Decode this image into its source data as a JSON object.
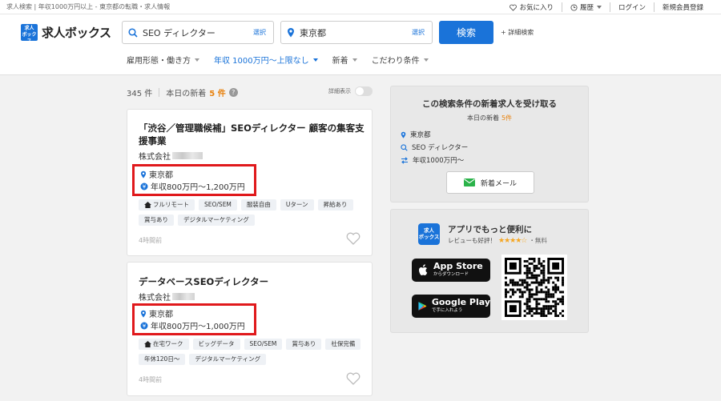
{
  "top_bar": {
    "breadcrumb": "求人検索 | 年収1000万円以上 - 東京都の転職・求人情報",
    "favorites": "お気に入り",
    "history": "履歴",
    "login": "ログイン",
    "register": "新規会員登録"
  },
  "header": {
    "logo_text": "求人ボックス",
    "logo_mark": "求人\nボックス",
    "keyword": {
      "value": "SEO ディレクター",
      "select": "選択"
    },
    "location": {
      "value": "東京都",
      "select": "選択"
    },
    "search_button": "検索",
    "advanced_search": "+ 詳細検索",
    "filters": [
      {
        "label": "雇用形態・働き方",
        "active": false
      },
      {
        "label": "年収 1000万円〜上限なし",
        "active": true
      },
      {
        "label": "新着",
        "active": false
      },
      {
        "label": "こだわり条件",
        "active": false
      }
    ]
  },
  "results": {
    "count": "345 件",
    "today_new_label": "本日の新着",
    "today_new_count": "5 件",
    "help": "?",
    "detail_toggle": "詳細表示"
  },
  "jobs": [
    {
      "title": "「渋谷／管理職候補」SEOディレクター 顧客の集客支援事業",
      "company": "株式会社",
      "location": "東京都",
      "salary": "年収800万円〜1,200万円",
      "tags": [
        "フルリモート",
        "SEO/SEM",
        "服装自由",
        "Uターン",
        "昇給あり",
        "賞与あり",
        "デジタルマーケティング"
      ],
      "posted": "4時間前"
    },
    {
      "title": "データベースSEOディレクター",
      "company": "株式会社",
      "location": "東京都",
      "salary": "年収800万円〜1,000万円",
      "tags": [
        "在宅ワーク",
        "ビッグデータ",
        "SEO/SEM",
        "賞与あり",
        "社保完備",
        "年休120日〜",
        "デジタルマーケティング"
      ],
      "posted": "4時間前"
    }
  ],
  "alert_panel": {
    "title": "この検索条件の新着求人を受け取る",
    "today_new_label": "本日の新着",
    "today_new_count": "5件",
    "conditions": {
      "location": "東京都",
      "keyword": "SEO ディレクター",
      "salary": "年収1000万円〜"
    },
    "mail_button": "新着メール"
  },
  "app_panel": {
    "icon_text": "求人\nボックス",
    "title": "アプリでもっと便利に",
    "review": "レビューも好評！",
    "rating": 4.5,
    "stars": "★★★★☆",
    "free": "・無料",
    "app_store": {
      "big": "App Store",
      "small": "からダウンロード"
    },
    "google_play": {
      "big": "Google Play",
      "small": "で手に入れよう"
    }
  },
  "colors": {
    "primary": "#1a73d9",
    "accent_orange": "#e8820e",
    "highlight_red": "#e0191c"
  }
}
